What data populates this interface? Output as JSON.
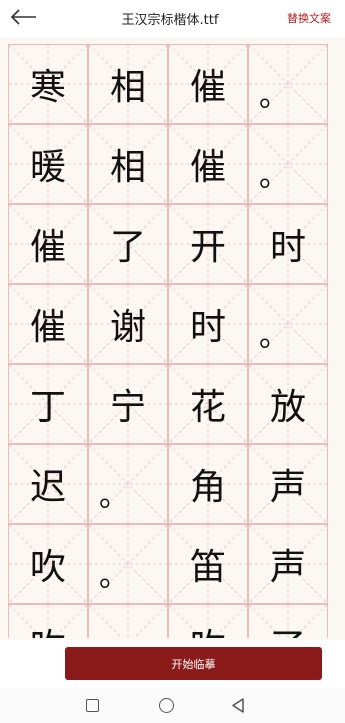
{
  "header": {
    "back_icon": "arrow-left-icon",
    "title": "王汉宗标楷体.ttf",
    "replace_label": "替换文案"
  },
  "grid": {
    "rows": [
      [
        "寒",
        "相",
        "催",
        "。"
      ],
      [
        "暖",
        "相",
        "催",
        "。"
      ],
      [
        "催",
        "了",
        "开",
        "时"
      ],
      [
        "催",
        "谢",
        "时",
        "。"
      ],
      [
        "丁",
        "宁",
        "花",
        "放"
      ],
      [
        "迟",
        "。",
        "角",
        "声"
      ],
      [
        "吹",
        "。",
        "笛",
        "声"
      ],
      [
        "吹",
        "",
        "吹",
        "了"
      ]
    ]
  },
  "footer": {
    "start_label": "开始临摹"
  },
  "navbar": {
    "recent_icon": "square-icon",
    "home_icon": "circle-icon",
    "back_icon": "triangle-back-icon"
  },
  "colors": {
    "accent": "#8b1a1a",
    "replace_text": "#b21f1f",
    "grid_line": "#f2b7b7"
  }
}
